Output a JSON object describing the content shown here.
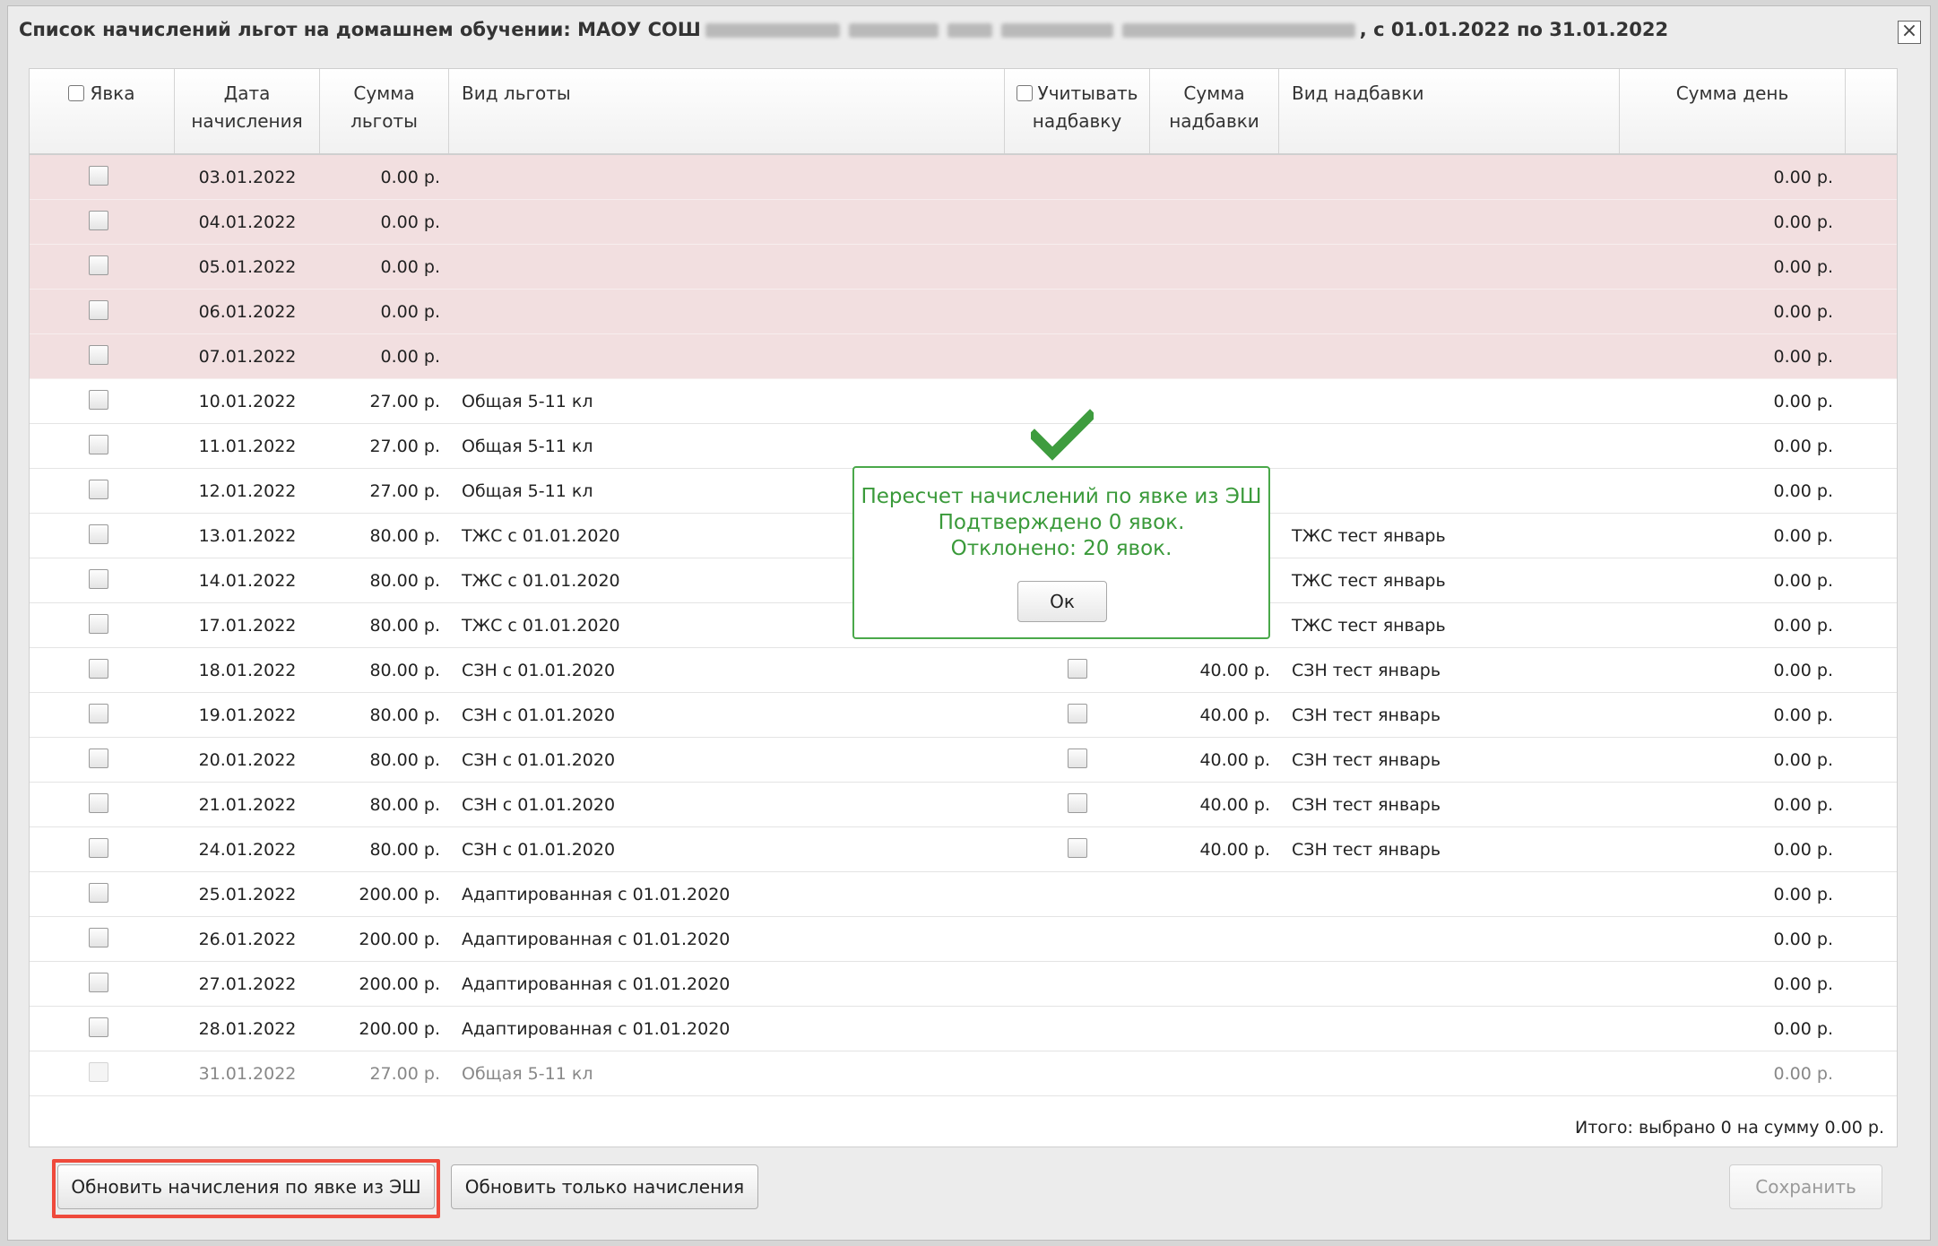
{
  "window": {
    "title_prefix": "Список начислений льгот на домашнем обучении: МАОУ СОШ",
    "title_suffix": ", с 01.01.2022 по 31.01.2022",
    "close_label": "×"
  },
  "table": {
    "headers": {
      "attendance": "Явка",
      "date_l1": "Дата",
      "date_l2": "начисления",
      "benefit_sum_l1": "Сумма",
      "benefit_sum_l2": "льготы",
      "benefit_type": "Вид льготы",
      "use_bonus_l1": "Учитывать",
      "use_bonus_l2": "надбавку",
      "bonus_sum_l1": "Сумма",
      "bonus_sum_l2": "надбавки",
      "bonus_type": "Вид надбавки",
      "day_sum": "Сумма день"
    },
    "rows": [
      {
        "date": "03.01.2022",
        "sum": "0.00 р.",
        "type": "",
        "bonus_sum": "",
        "bonus_type": "",
        "day_sum": "0.00 р."
      },
      {
        "date": "04.01.2022",
        "sum": "0.00 р.",
        "type": "",
        "bonus_sum": "",
        "bonus_type": "",
        "day_sum": "0.00 р."
      },
      {
        "date": "05.01.2022",
        "sum": "0.00 р.",
        "type": "",
        "bonus_sum": "",
        "bonus_type": "",
        "day_sum": "0.00 р."
      },
      {
        "date": "06.01.2022",
        "sum": "0.00 р.",
        "type": "",
        "bonus_sum": "",
        "bonus_type": "",
        "day_sum": "0.00 р."
      },
      {
        "date": "07.01.2022",
        "sum": "0.00 р.",
        "type": "",
        "bonus_sum": "",
        "bonus_type": "",
        "day_sum": "0.00 р."
      },
      {
        "date": "10.01.2022",
        "sum": "27.00 р.",
        "type": "Общая 5-11 кл",
        "bonus_sum": "",
        "bonus_type": "",
        "day_sum": "0.00 р."
      },
      {
        "date": "11.01.2022",
        "sum": "27.00 р.",
        "type": "Общая 5-11 кл",
        "bonus_sum": "",
        "bonus_type": "",
        "day_sum": "0.00 р."
      },
      {
        "date": "12.01.2022",
        "sum": "27.00 р.",
        "type": "Общая 5-11 кл",
        "bonus_sum": "",
        "bonus_type": "",
        "day_sum": "0.00 р."
      },
      {
        "date": "13.01.2022",
        "sum": "80.00 р.",
        "type": "ТЖС с 01.01.2020",
        "bonus_sum": "",
        "bonus_type": "ТЖС тест январь",
        "day_sum": "0.00 р."
      },
      {
        "date": "14.01.2022",
        "sum": "80.00 р.",
        "type": "ТЖС с 01.01.2020",
        "bonus_sum": "",
        "bonus_type": "ТЖС тест январь",
        "day_sum": "0.00 р."
      },
      {
        "date": "17.01.2022",
        "sum": "80.00 р.",
        "type": "ТЖС с 01.01.2020",
        "bonus_sum": "",
        "bonus_type": "ТЖС тест январь",
        "day_sum": "0.00 р."
      },
      {
        "date": "18.01.2022",
        "sum": "80.00 р.",
        "type": "СЗН с 01.01.2020",
        "bonus_sum": "40.00 р.",
        "bonus_type": "СЗН тест январь",
        "day_sum": "0.00 р."
      },
      {
        "date": "19.01.2022",
        "sum": "80.00 р.",
        "type": "СЗН с 01.01.2020",
        "bonus_sum": "40.00 р.",
        "bonus_type": "СЗН тест январь",
        "day_sum": "0.00 р."
      },
      {
        "date": "20.01.2022",
        "sum": "80.00 р.",
        "type": "СЗН с 01.01.2020",
        "bonus_sum": "40.00 р.",
        "bonus_type": "СЗН тест январь",
        "day_sum": "0.00 р."
      },
      {
        "date": "21.01.2022",
        "sum": "80.00 р.",
        "type": "СЗН с 01.01.2020",
        "bonus_sum": "40.00 р.",
        "bonus_type": "СЗН тест январь",
        "day_sum": "0.00 р."
      },
      {
        "date": "24.01.2022",
        "sum": "80.00 р.",
        "type": "СЗН с 01.01.2020",
        "bonus_sum": "40.00 р.",
        "bonus_type": "СЗН тест январь",
        "day_sum": "0.00 р."
      },
      {
        "date": "25.01.2022",
        "sum": "200.00 р.",
        "type": "Адаптированная с 01.01.2020",
        "bonus_sum": "",
        "bonus_type": "",
        "day_sum": "0.00 р."
      },
      {
        "date": "26.01.2022",
        "sum": "200.00 р.",
        "type": "Адаптированная с 01.01.2020",
        "bonus_sum": "",
        "bonus_type": "",
        "day_sum": "0.00 р."
      },
      {
        "date": "27.01.2022",
        "sum": "200.00 р.",
        "type": "Адаптированная с 01.01.2020",
        "bonus_sum": "",
        "bonus_type": "",
        "day_sum": "0.00 р."
      },
      {
        "date": "28.01.2022",
        "sum": "200.00 р.",
        "type": "Адаптированная с 01.01.2020",
        "bonus_sum": "",
        "bonus_type": "",
        "day_sum": "0.00 р."
      },
      {
        "date": "31.01.2022",
        "sum": "27.00 р.",
        "type": "Общая 5-11 кл",
        "bonus_sum": "",
        "bonus_type": "",
        "day_sum": "0.00 р."
      }
    ],
    "total": "Итого: выбрано 0 на сумму 0.00 р."
  },
  "buttons": {
    "update_by_attendance": "Обновить начисления по явке из ЭШ",
    "update_only": "Обновить только начисления",
    "save": "Сохранить"
  },
  "dialog": {
    "line1": "Пересчет начислений по явке из ЭШ",
    "line2": "Подтверждено 0 явок.",
    "line3": "Отклонено: 20 явок.",
    "ok": "Ок"
  },
  "colors": {
    "pink_row": "#f2dfe0",
    "success_green": "#3a9a3a",
    "highlight_red": "#ef4a3c"
  }
}
